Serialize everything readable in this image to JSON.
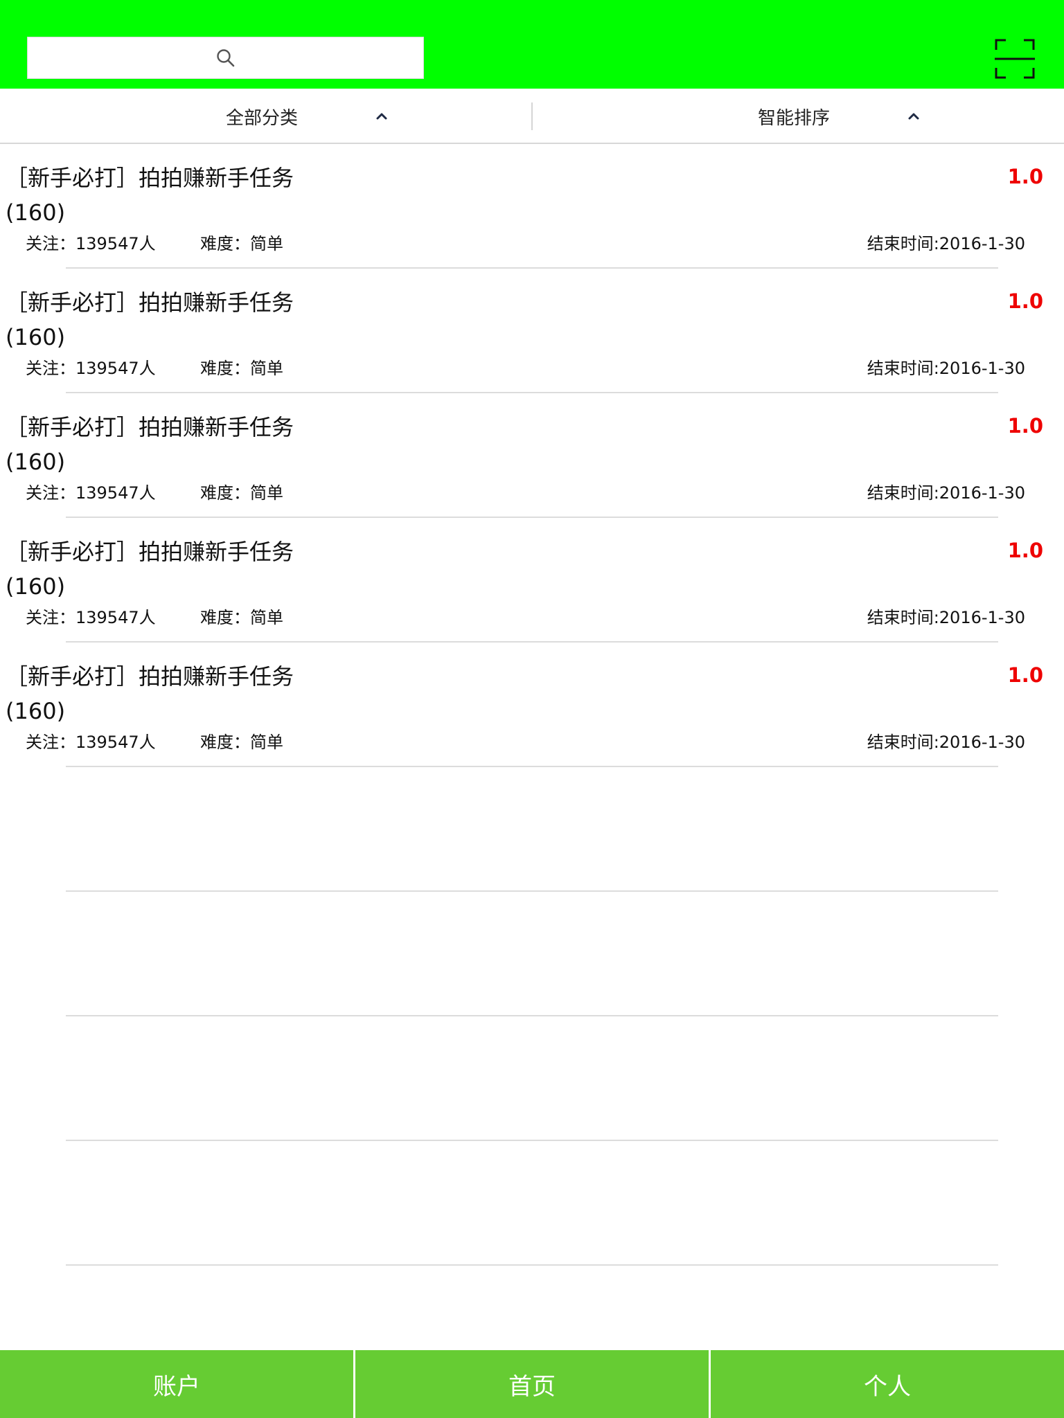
{
  "header": {
    "background": "#00ff00",
    "search_icon": "search-icon",
    "scan_icon": "scan-icon"
  },
  "filters": {
    "category_label": "全部分类",
    "sort_label": "智能排序",
    "caret_icon": "chevron-up-icon"
  },
  "tasks": [
    {
      "title": "［新手必打］拍拍赚新手任务(160)",
      "price": "1.0",
      "follow": "关注：139547人",
      "difficulty": "难度：简单",
      "end_time": "结束时间:2016-1-30"
    },
    {
      "title": "［新手必打］拍拍赚新手任务(160)",
      "price": "1.0",
      "follow": "关注：139547人",
      "difficulty": "难度：简单",
      "end_time": "结束时间:2016-1-30"
    },
    {
      "title": "［新手必打］拍拍赚新手任务(160)",
      "price": "1.0",
      "follow": "关注：139547人",
      "difficulty": "难度：简单",
      "end_time": "结束时间:2016-1-30"
    },
    {
      "title": "［新手必打］拍拍赚新手任务(160)",
      "price": "1.0",
      "follow": "关注：139547人",
      "difficulty": "难度：简单",
      "end_time": "结束时间:2016-1-30"
    },
    {
      "title": "［新手必打］拍拍赚新手任务(160)",
      "price": "1.0",
      "follow": "关注：139547人",
      "difficulty": "难度：简单",
      "end_time": "结束时间:2016-1-30"
    }
  ],
  "tabbar": {
    "tabs": [
      {
        "label": "账户"
      },
      {
        "label": "首页"
      },
      {
        "label": "个人"
      }
    ],
    "color": "#66cc33"
  },
  "colors": {
    "price": "#ee0000",
    "separator": "#dcdcdc"
  }
}
